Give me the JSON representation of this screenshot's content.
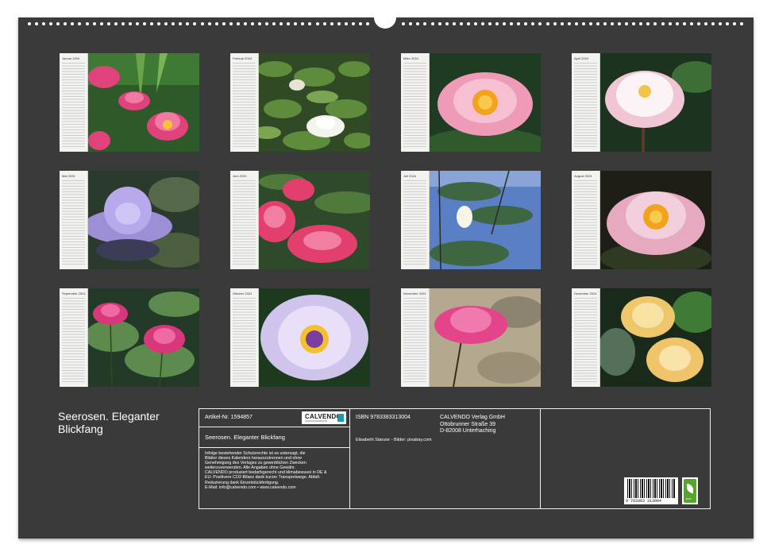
{
  "calendar": {
    "title": "Seerosen. Eleganter Blickfang",
    "months": [
      {
        "label": "Januar 2024"
      },
      {
        "label": "Februar 2024"
      },
      {
        "label": "März 2024"
      },
      {
        "label": "April 2024"
      },
      {
        "label": "Mai 2024"
      },
      {
        "label": "Juni 2024"
      },
      {
        "label": "Juli 2024"
      },
      {
        "label": "August 2024"
      },
      {
        "label": "September 2024"
      },
      {
        "label": "Oktober 2024"
      },
      {
        "label": "November 2024"
      },
      {
        "label": "Dezember 2024"
      }
    ]
  },
  "info": {
    "article": "Artikel-Nr. 1594857",
    "logo_text": "CALVENDO",
    "subtitle": "Seerosen. Eleganter Blickfang",
    "legal": [
      "Infolge bestehender Schutzrechte ist es untersagt, die",
      "Blätter dieses Kalenders herauszutrennen und ohne",
      "Genehmigung des Verlages zu gewerblichen Zwecken",
      "weiterzuverwenden. Alle Angaben ohne Gewähr.",
      "CALVENDO produziert bedarfsgerecht und klimabewusst in DE &",
      "EU: Positivere CO2-Bilanz dank kurzer Transportwege. Abfall-",
      "Reduzierung dank Einzelstückfertigung.",
      "E-Mail: info@calvendo.com • www.calvendo.com"
    ],
    "isbn": "ISBN 9783383313004",
    "publisher": [
      "CALVENDO Verlag GmbH",
      "Ottobrunner Straße 39",
      "D-82008 Unterhaching"
    ],
    "credits": "Elisabeth Stanzer - Bilder: pixabay.com",
    "barcode_number": "9 783383 313004",
    "eco_label": "eco"
  }
}
